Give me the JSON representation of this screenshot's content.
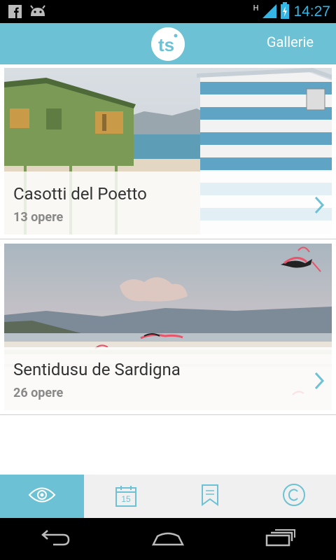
{
  "status_bar": {
    "time": "14:27",
    "network_label": "H",
    "icons": [
      "facebook-icon",
      "android-icon",
      "signal-icon",
      "battery-icon"
    ]
  },
  "action_bar": {
    "logo_icon": "ts-logo",
    "gallerie_label": "Gallerie"
  },
  "galleries": [
    {
      "title": "Casotti del Poetto",
      "count": "13 opere"
    },
    {
      "title": "Sentidusu de Sardigna",
      "count": "26 opere"
    }
  ],
  "tabs": [
    {
      "icon": "eye-icon",
      "active": true
    },
    {
      "icon": "calendar-icon",
      "label": "15",
      "active": false
    },
    {
      "icon": "bookmark-icon",
      "active": false
    },
    {
      "icon": "copyright-icon",
      "active": false
    }
  ],
  "nav_bar": {
    "icons": [
      "back-icon",
      "home-icon",
      "recent-apps-icon"
    ]
  },
  "colors": {
    "accent": "#6cc2d4",
    "status_time": "#33b5e5",
    "tab_background": "#f0f0f0"
  }
}
